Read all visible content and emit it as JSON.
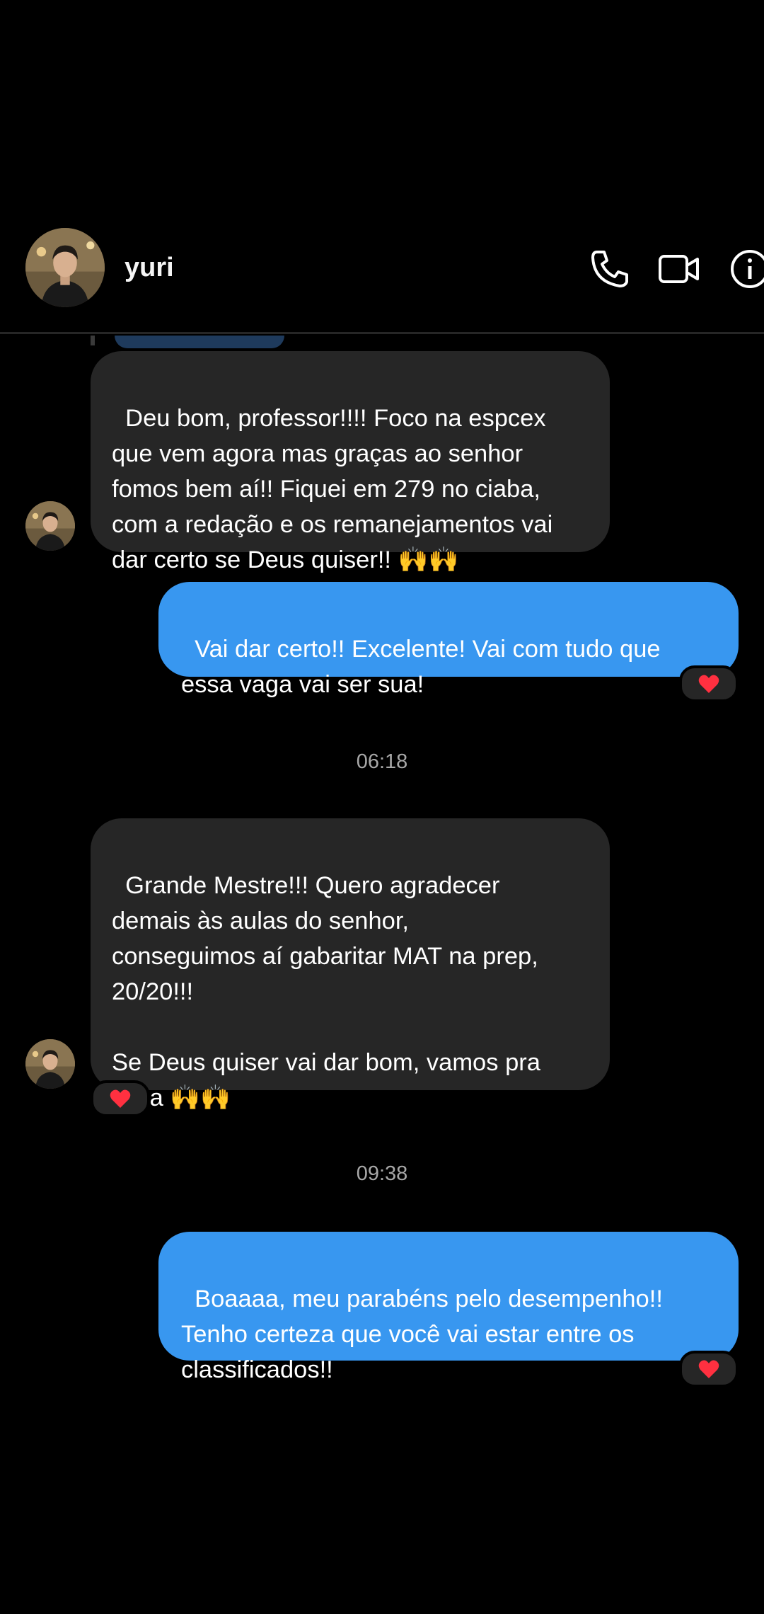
{
  "header": {
    "contact_name": "yuri",
    "avatar": "profile-photo",
    "icons": [
      "phone-icon",
      "video-camera-icon",
      "info-icon"
    ]
  },
  "messages": [
    {
      "direction": "incoming",
      "text": "Deu bom, professor!!!! Foco na espcex\nque vem agora mas graças ao senhor\nfomos bem aí!! Fiquei em 279 no ciaba,\ncom a redação e os remanejamentos vai\ndar certo se Deus quiser!! 🙌🙌"
    },
    {
      "direction": "outgoing",
      "text": "Vai dar certo!! Excelente! Vai com tudo que\nessa vaga vai ser sua!",
      "reaction": "❤️"
    },
    {
      "timestamp": "06:18"
    },
    {
      "direction": "incoming",
      "text": "Grande Mestre!!! Quero agradecer\ndemais às aulas do senhor,\nconseguimos aí gabaritar MAT na prep,\n20/20!!!\n\nSe Deus quiser vai dar bom, vamos pra\ncima 🙌🙌",
      "reaction": "❤️"
    },
    {
      "timestamp": "09:38"
    },
    {
      "direction": "outgoing",
      "text": "Boaaaa, meu parabéns pelo desempenho!!\nTenho certeza que você vai estar entre os\nclassificados!!",
      "reaction": "❤️"
    }
  ],
  "colors": {
    "background": "#000000",
    "incoming_bubble": "#262626",
    "outgoing_bubble": "#3897f0",
    "timestamp_text": "#a8a8a8",
    "heart": "#ff3040"
  }
}
